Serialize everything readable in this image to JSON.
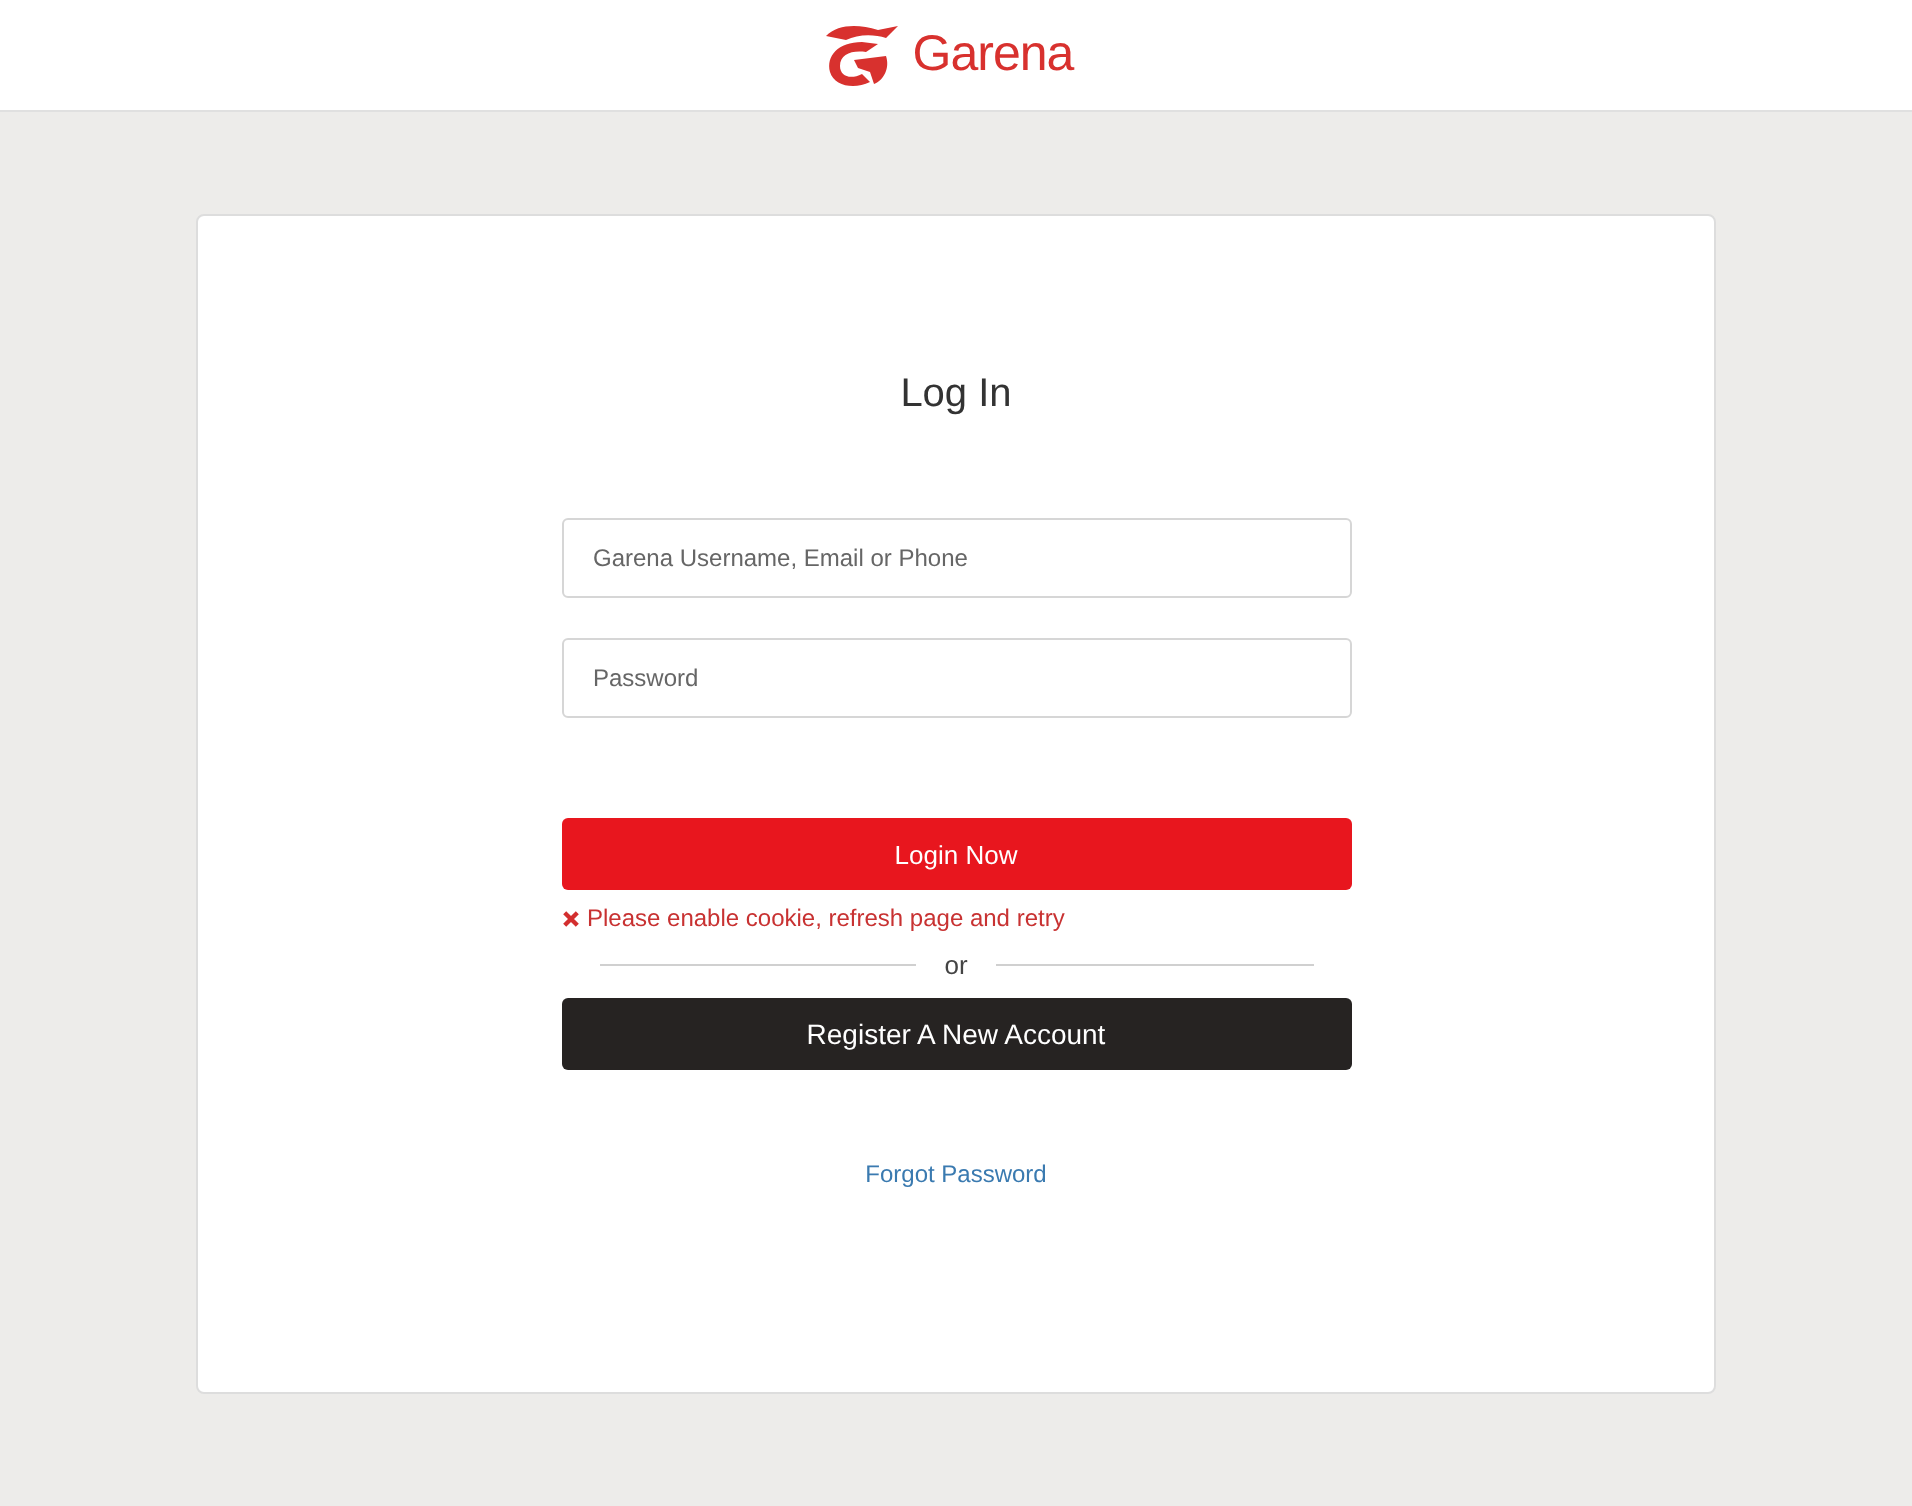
{
  "header": {
    "brand": "Garena"
  },
  "form": {
    "title": "Log In",
    "fields": [
      {
        "placeholder": "Garena Username, Email or Phone"
      },
      {
        "placeholder": "Password"
      }
    ],
    "login_button": "Login Now",
    "error": "Please enable cookie, refresh page and retry",
    "separator": "or",
    "register_button": "Register A New Account",
    "forgot_link": "Forgot Password"
  }
}
